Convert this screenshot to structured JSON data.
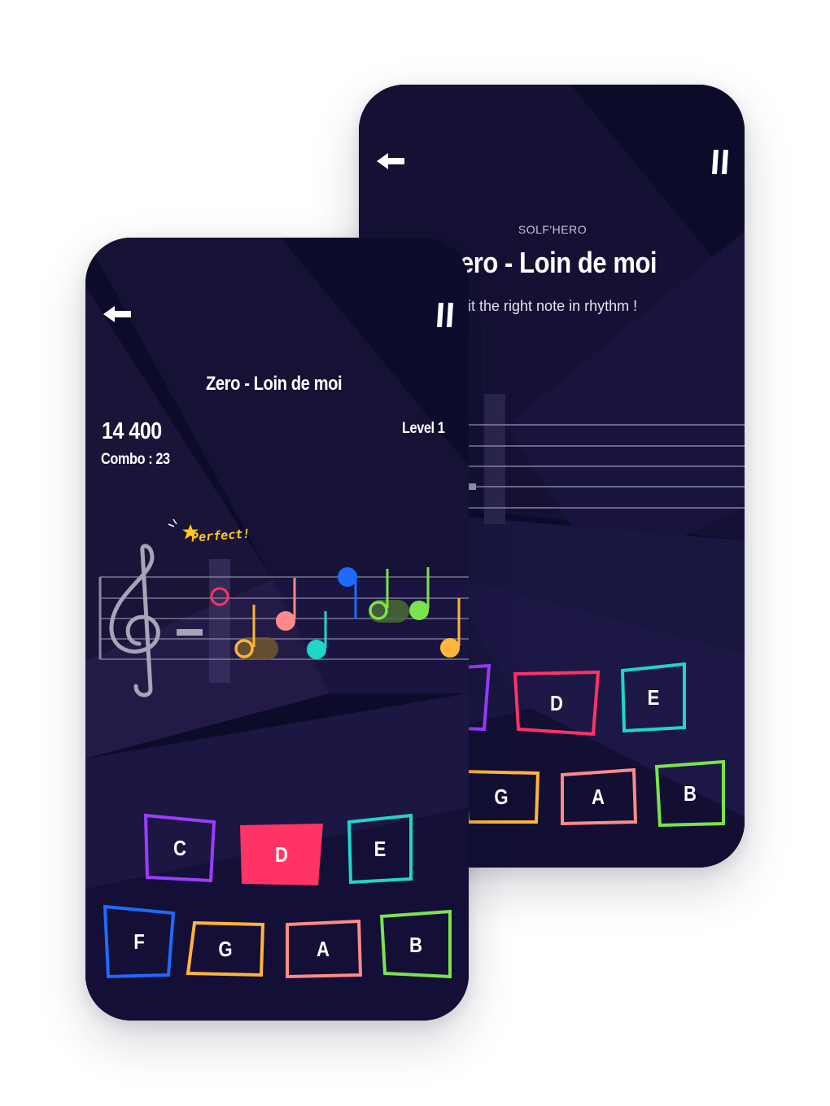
{
  "back_screen": {
    "app_name": "SOLF'HERO",
    "song_title": "ero - Loin de moi",
    "instruction": "it the right note in rhythm !",
    "keys_row1": [
      "",
      "D",
      "E"
    ],
    "keys_row2": [
      "G",
      "A",
      "B"
    ]
  },
  "front_screen": {
    "song_title": "Zero - Loin de moi",
    "score": "14 400",
    "combo": "Combo : 23",
    "level": "Level 1",
    "feedback": "Perfect!",
    "keys_row1": [
      "C",
      "D",
      "E"
    ],
    "keys_row2": [
      "F",
      "G",
      "A",
      "B"
    ],
    "pressed_key": "D"
  },
  "colors": {
    "background": "#0d0b2a",
    "C": "#9b3dff",
    "D": "#ff3366",
    "E": "#1fd6c8",
    "F": "#1e6bff",
    "G": "#ffb43a",
    "A": "#ff8a8a",
    "B": "#7be34d",
    "perfect": "#ffc81e"
  },
  "icons": [
    "back-arrow-icon",
    "pause-icon",
    "treble-clef-icon",
    "star-icon"
  ]
}
